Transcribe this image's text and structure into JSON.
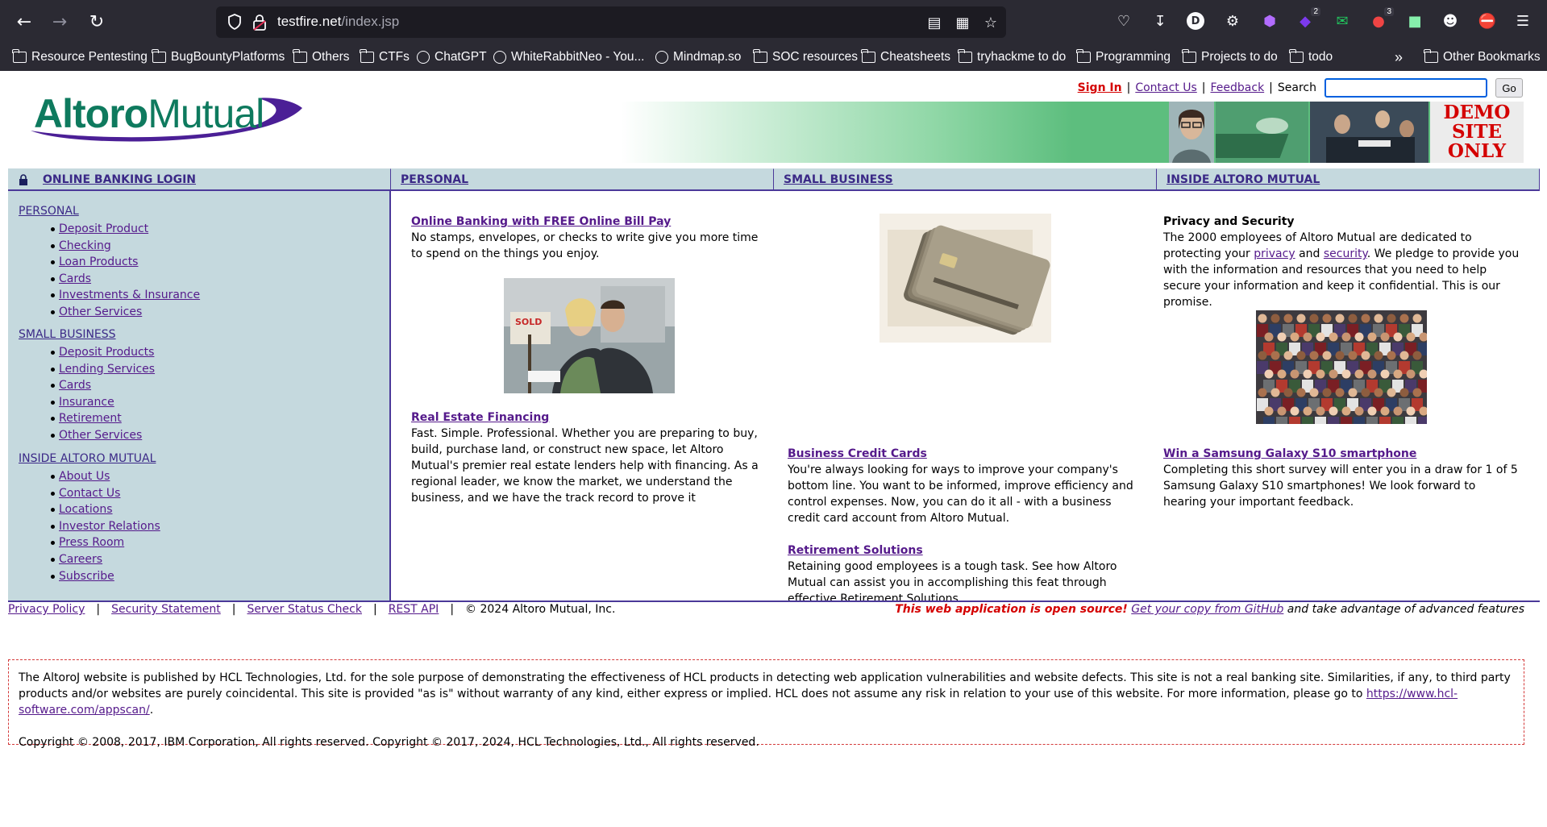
{
  "browser": {
    "url_host": "testfire.net",
    "url_path": "/index.jsp",
    "extension_badges": [
      "2",
      "3"
    ],
    "bookmarks": [
      {
        "label": "Resource Pentesting",
        "icon": "folder-icon"
      },
      {
        "label": "BugBountyPlatforms",
        "icon": "folder-icon"
      },
      {
        "label": "Others",
        "icon": "folder-icon"
      },
      {
        "label": "CTFs",
        "icon": "folder-icon"
      },
      {
        "label": "ChatGPT",
        "icon": "openai-icon"
      },
      {
        "label": "WhiteRabbitNeo - You...",
        "icon": "globe-icon"
      },
      {
        "label": "Mindmap.so",
        "icon": "globe-icon"
      },
      {
        "label": "SOC resources",
        "icon": "folder-icon"
      },
      {
        "label": "Cheatsheets",
        "icon": "folder-icon"
      },
      {
        "label": "tryhackme to do",
        "icon": "folder-icon"
      },
      {
        "label": "Programming",
        "icon": "folder-icon"
      },
      {
        "label": "Projects to do",
        "icon": "folder-icon"
      },
      {
        "label": "todo",
        "icon": "folder-icon"
      }
    ],
    "other_bookmarks": "Other Bookmarks"
  },
  "header": {
    "logo_bold": "Altoro",
    "logo_light": "Mutual",
    "sign_in": "Sign In",
    "contact_us": "Contact Us",
    "feedback": "Feedback",
    "search_label": "Search",
    "search_value": "",
    "go_label": "Go",
    "demo_line1": "DEMO",
    "demo_line2": "SITE",
    "demo_line3": "ONLY"
  },
  "nav": {
    "login": "ONLINE BANKING LOGIN",
    "personal": "PERSONAL",
    "small_business": "SMALL BUSINESS",
    "inside": "INSIDE ALTORO MUTUAL"
  },
  "sidebar": {
    "personal": {
      "heading": "PERSONAL",
      "items": [
        "Deposit Product",
        "Checking",
        "Loan Products",
        "Cards",
        "Investments & Insurance",
        "Other Services"
      ]
    },
    "small_business": {
      "heading": "SMALL BUSINESS",
      "items": [
        "Deposit Products",
        "Lending Services",
        "Cards",
        "Insurance",
        "Retirement",
        "Other Services"
      ]
    },
    "inside": {
      "heading": "INSIDE ALTORO MUTUAL",
      "items": [
        "About Us",
        "Contact Us",
        "Locations",
        "Investor Relations",
        "Press Room",
        "Careers",
        "Subscribe"
      ]
    }
  },
  "col1": {
    "title1": "Online Banking with FREE Online Bill Pay",
    "text1": "No stamps, envelopes, or checks to write give you more time to spend on the things you enjoy.",
    "title2": "Real Estate Financing",
    "text2": "Fast. Simple. Professional. Whether you are preparing to buy, build, purchase land, or construct new space, let Altoro Mutual's premier real estate lenders help with financing. As a regional leader, we know the market, we understand the business, and we have the track record to prove it"
  },
  "col2": {
    "title1": "Business Credit Cards",
    "text1": "You're always looking for ways to improve your company's bottom line. You want to be informed, improve efficiency and control expenses. Now, you can do it all - with a business credit card account from Altoro Mutual.",
    "title2": "Retirement Solutions",
    "text2": "Retaining good employees is a tough task. See how Altoro Mutual can assist you in accomplishing this feat through effective Retirement Solutions."
  },
  "col3": {
    "title1": "Privacy and Security",
    "text1_a": "The 2000 employees of Altoro Mutual are dedicated to protecting your",
    "privacy_link": "privacy",
    "text1_b": "and",
    "security_link": "security",
    "text1_c": ". We pledge to provide you with the information and resources that you need to help secure your information and keep it confidential. This is our promise.",
    "title2": "Win a Samsung Galaxy S10 smartphone",
    "text2": "Completing this short survey will enter you in a draw for 1 of 5 Samsung Galaxy S10 smartphones! We look forward to hearing your important feedback."
  },
  "footer": {
    "links": [
      "Privacy Policy",
      "Security Statement",
      "Server Status Check",
      "REST API"
    ],
    "copyright": "© 2024 Altoro Mutual, Inc.",
    "open_source": "This web application is open source!",
    "github_link": "Get your copy from GitHub",
    "open_source_tail": "and take advantage of advanced features"
  },
  "disclaimer": {
    "text": "The AltoroJ website is published by HCL Technologies, Ltd. for the sole purpose of demonstrating the effectiveness of HCL products in detecting web application vulnerabilities and website defects. This site is not a real banking site. Similarities, if any, to third party products and/or websites are purely coincidental. This site is provided \"as is\" without warranty of any kind, either express or implied. HCL does not assume any risk in relation to your use of this website. For more information, please go to",
    "link": "https://www.hcl-software.com/appscan/",
    "copyright": "Copyright © 2008, 2017, IBM Corporation, All rights reserved. Copyright © 2017, 2024, HCL Technologies, Ltd., All rights reserved."
  }
}
